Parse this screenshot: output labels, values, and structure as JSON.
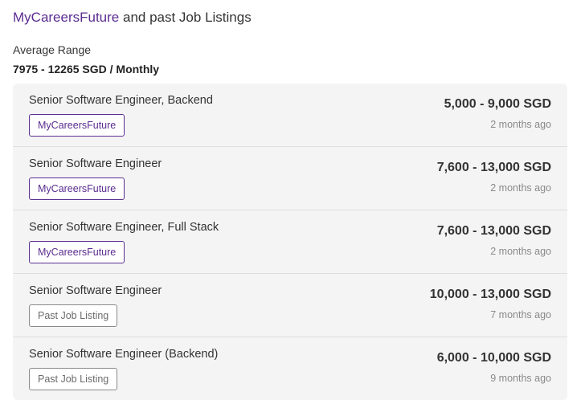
{
  "header": {
    "brand": "MyCareersFuture",
    "title_rest": " and past Job Listings"
  },
  "average": {
    "label": "Average Range",
    "value": "7975 - 12265 SGD / Monthly"
  },
  "colors": {
    "brand_purple": "#5b2d90",
    "past_tag_gray": "#8a8a8a",
    "list_background": "#f4f4f4"
  },
  "listings": [
    {
      "title": "Senior Software Engineer, Backend",
      "tag": "MyCareersFuture",
      "tag_type": "mycareersfuture",
      "salary": "5,000 - 9,000 SGD",
      "posted": "2 months ago"
    },
    {
      "title": "Senior Software Engineer",
      "tag": "MyCareersFuture",
      "tag_type": "mycareersfuture",
      "salary": "7,600 - 13,000 SGD",
      "posted": "2 months ago"
    },
    {
      "title": "Senior Software Engineer, Full Stack",
      "tag": "MyCareersFuture",
      "tag_type": "mycareersfuture",
      "salary": "7,600 - 13,000 SGD",
      "posted": "2 months ago"
    },
    {
      "title": "Senior Software Engineer",
      "tag": "Past Job Listing",
      "tag_type": "past",
      "salary": "10,000 - 13,000 SGD",
      "posted": "7 months ago"
    },
    {
      "title": "Senior Software Engineer (Backend)",
      "tag": "Past Job Listing",
      "tag_type": "past",
      "salary": "6,000 - 10,000 SGD",
      "posted": "9 months ago"
    }
  ]
}
